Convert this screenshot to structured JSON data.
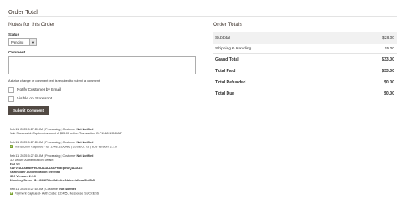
{
  "page": {
    "title": "Order Total"
  },
  "notes": {
    "heading": "Notes for this Order",
    "status_label": "Status",
    "status_value": "Pending",
    "comment_label": "Comment",
    "comment_value": "",
    "note": "A status change or comment text is required to submit a comment.",
    "notify_label": "Notify Customer by Email",
    "visible_label": "Visible on Storefront",
    "submit_label": "Submit Comment"
  },
  "history": [
    {
      "date": "Feb 11, 2025",
      "time": "5:27:10 AM",
      "status": "Processing",
      "customer_label": "Customer",
      "customer_state": "Not Notified",
      "lines": [
        "Sale Successful. Captured amount of $33.00 online. Transaction ID: \"134811906586\""
      ]
    },
    {
      "date": "Feb 11, 2025",
      "time": "5:27:10 AM",
      "status": "Processing",
      "customer_label": "Customer",
      "customer_state": "Not Notified",
      "lines": [
        "Transaction Captured - ID: 134811906586 | 3DS ECI: 05 | 3DS Version: 2.2.0"
      ],
      "has_tick": true
    },
    {
      "date": "Feb 11, 2025",
      "time": "5:27:10 AM",
      "status": "Processing",
      "customer_label": "Customer",
      "customer_state": "Not Notified",
      "lines": [
        "3D Secure Authentication Details:",
        "ECI: 05",
        "CAVV: AAABBEFtsDIAAAAAAAFf0dEpbWQAAAA=",
        "Cardholder Authentication: Verified",
        "3DS Version: 2.2.0",
        "Directory Server ID: 4068f78b-8fd3-4ee0-bfce-9d9eaa50d5b5"
      ],
      "bold_keys": [
        "ECI:",
        "CAVV:",
        "Cardholder Authentication:",
        "3DS Version:",
        "Directory Server ID:"
      ]
    },
    {
      "date": "Feb 11, 2025",
      "time": "5:27:10 AM",
      "status": "",
      "customer_label": "Customer",
      "customer_state": "Not Notified",
      "lines": [
        "Payment Captured - Auth Code: 123456, Response: SUCCESS"
      ],
      "has_tick": true
    }
  ],
  "totals": {
    "heading": "Order Totals",
    "rows": [
      {
        "label": "Subtotal",
        "value": "$28.00"
      },
      {
        "label": "Shipping & Handling",
        "value": "$5.00"
      },
      {
        "label": "Grand Total",
        "value": "$33.00"
      },
      {
        "label": "Total Paid",
        "value": "$33.00"
      },
      {
        "label": "Total Refunded",
        "value": "$0.00"
      },
      {
        "label": "Total Due",
        "value": "$0.00"
      }
    ]
  },
  "colors": {
    "primary_button": "#514943",
    "success_tick": "#79a22e",
    "subtotal_bg": "#f1f1f1"
  }
}
